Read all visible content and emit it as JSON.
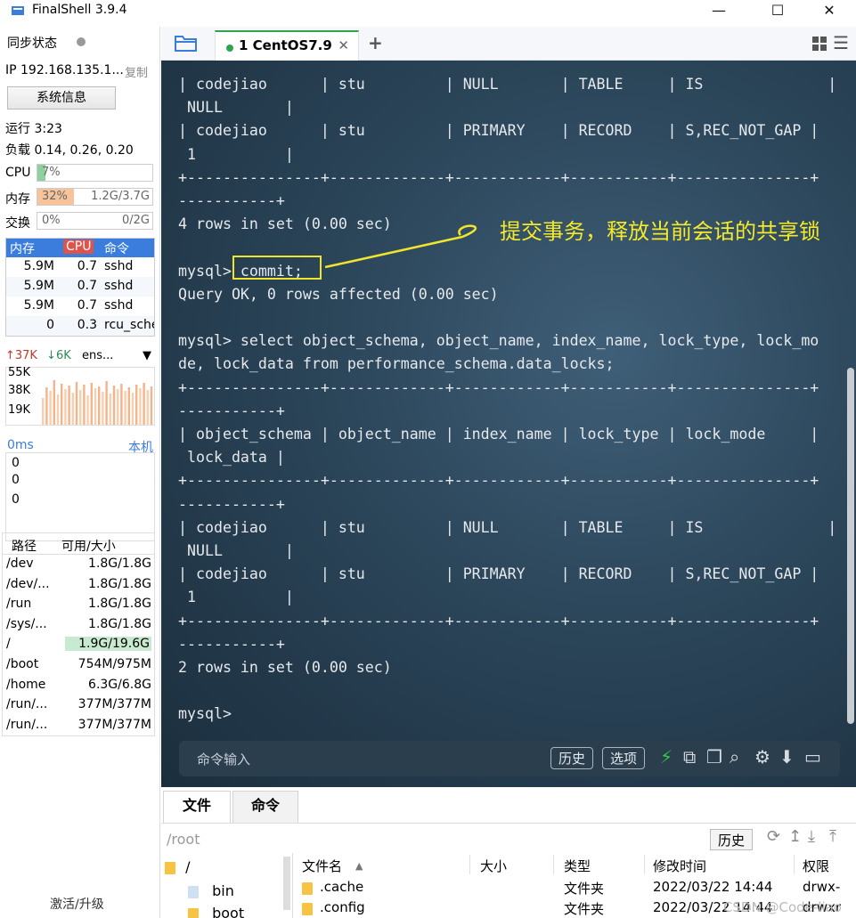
{
  "window": {
    "title": "FinalShell 3.9.4",
    "minimize": "—",
    "maximize": "☐",
    "close": "✕"
  },
  "sidebar": {
    "sync_label": "同步状态",
    "ip": "IP 192.168.135.1...",
    "copy": "复制",
    "sysinfo_button": "系统信息",
    "uptime": "运行 3:23",
    "load": "负载 0.14, 0.26, 0.20",
    "cpu": {
      "label": "CPU",
      "percent_text": "7%",
      "percent": 7
    },
    "mem": {
      "label": "内存",
      "percent_text": "32%",
      "amount": "1.2G/3.7G",
      "percent": 32
    },
    "swap": {
      "label": "交换",
      "percent_text": "0%",
      "amount": "0/2G",
      "percent": 0
    },
    "processes": {
      "headers": [
        "内存",
        "CPU",
        "命令"
      ],
      "rows": [
        {
          "mem": "5.9M",
          "cpu": "0.7",
          "cmd": "sshd"
        },
        {
          "mem": "5.9M",
          "cpu": "0.7",
          "cmd": "sshd"
        },
        {
          "mem": "5.9M",
          "cpu": "0.7",
          "cmd": "sshd"
        },
        {
          "mem": "0",
          "cpu": "0.3",
          "cmd": "rcu_sche"
        }
      ]
    },
    "network": {
      "up": "↑37K",
      "down": "↓6K",
      "interface": "ens...",
      "y_labels": [
        "55K",
        "38K",
        "19K"
      ]
    },
    "ping": {
      "latency": "0ms",
      "target": "本机",
      "values": [
        "0",
        "0",
        "0"
      ]
    },
    "disks": {
      "headers": [
        "路径",
        "可用/大小"
      ],
      "rows": [
        {
          "path": "/dev",
          "size": "1.8G/1.8G"
        },
        {
          "path": "/dev/...",
          "size": "1.8G/1.8G"
        },
        {
          "path": "/run",
          "size": "1.8G/1.8G"
        },
        {
          "path": "/sys/...",
          "size": "1.8G/1.8G"
        },
        {
          "path": "/",
          "size": "1.9G/19.6G"
        },
        {
          "path": "/boot",
          "size": "754M/975M"
        },
        {
          "path": "/home",
          "size": "6.3G/6.8G"
        },
        {
          "path": "/run/...",
          "size": "377M/377M"
        },
        {
          "path": "/run/...",
          "size": "377M/377M"
        }
      ]
    },
    "activate": "激活/升级"
  },
  "tabs": {
    "active_tab": "1 CentOS7.9",
    "close": "✕",
    "add": "+",
    "menu": "☰"
  },
  "terminal": {
    "text": "| codejiao      | stu         | NULL       | TABLE     | IS              |\n NULL       |\n| codejiao      | stu         | PRIMARY    | RECORD    | S,REC_NOT_GAP |\n 1          |\n+---------------+-------------+------------+-----------+---------------+\n-----------+\n4 rows in set (0.00 sec)\n\nmysql> commit;\nQuery OK, 0 rows affected (0.00 sec)\n\nmysql> select object_schema, object_name, index_name, lock_type, lock_mo\nde, lock_data from performance_schema.data_locks;\n+---------------+-------------+------------+-----------+---------------+\n-----------+\n| object_schema | object_name | index_name | lock_type | lock_mode     |\n lock_data |\n+---------------+-------------+------------+-----------+---------------+\n-----------+\n| codejiao      | stu         | NULL       | TABLE     | IS              |\n NULL       |\n| codejiao      | stu         | PRIMARY    | RECORD    | S,REC_NOT_GAP |\n 1          |\n+---------------+-------------+------------+-----------+---------------+\n-----------+\n2 rows in set (0.00 sec)\n\nmysql>",
    "annotation": "提交事务，释放当前会话的共享锁",
    "command_placeholder": "命令输入",
    "history_button": "历史",
    "options_button": "选项",
    "annotation_color": "#f5ea2a"
  },
  "file_panel": {
    "tab_files": "文件",
    "tab_commands": "命令",
    "path": "/root",
    "history_button": "历史",
    "tree": [
      {
        "name": "/"
      },
      {
        "name": "bin"
      },
      {
        "name": "boot"
      }
    ],
    "columns": [
      "文件名",
      "大小",
      "类型",
      "修改时间",
      "权限"
    ],
    "rows": [
      {
        "name": ".cache",
        "size": "",
        "type": "文件夹",
        "mtime": "2022/03/22 14:44",
        "perm": "drwx-"
      },
      {
        "name": ".config",
        "size": "",
        "type": "文件夹",
        "mtime": "2022/03/22 14:44",
        "perm": "drwxr"
      }
    ],
    "watermark": "CSDN @Code-liao"
  },
  "colors": {
    "accent_blue": "#3b7ddd",
    "active_green": "#2ea44f",
    "mem_orange": "#f7c39b",
    "highlight_yellow": "#f1e42c"
  }
}
